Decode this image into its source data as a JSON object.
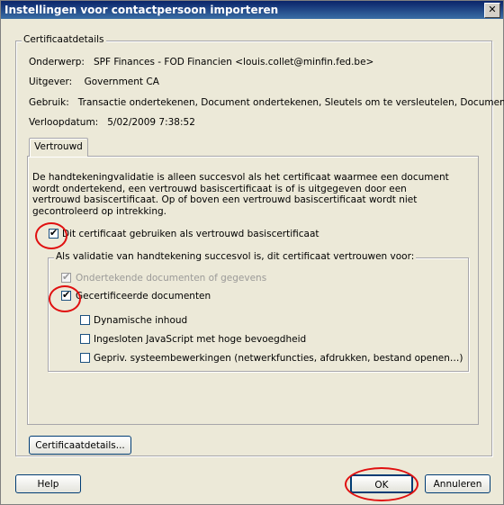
{
  "window": {
    "title": "Instellingen voor contactpersoon importeren",
    "close_symbol": "✕"
  },
  "certdetails": {
    "group_title": "Certificaatdetails",
    "subject_label": "Onderwerp:",
    "subject_value": "SPF Finances - FOD Financien <louis.collet@minfin.fed.be>",
    "issuer_label": "Uitgever:",
    "issuer_value": "Government CA",
    "usage_label": "Gebruik:",
    "usage_value": "Transactie ondertekenen, Document ondertekenen, Sleutels om te versleutelen, Document",
    "expiry_label": "Verloopdatum:",
    "expiry_value": "5/02/2009 7:38:52"
  },
  "tabs": [
    {
      "label": "Vertrouwd"
    }
  ],
  "trust": {
    "description": "De handtekeningvalidatie is alleen succesvol als het certificaat waarmee een document wordt ondertekend, een vertrouwd basiscertificaat is of is uitgegeven door een vertrouwd basiscertificaat. Op of boven een vertrouwd basiscertificaat wordt niet gecontroleerd op intrekking.",
    "root_checkbox": {
      "label": "Dit certificaat gebruiken als vertrouwd basiscertificaat",
      "checked": true
    },
    "subgroup_title": "Als validatie van handtekening succesvol is, dit certificaat vertrouwen voor:",
    "options": [
      {
        "label": "Ondertekende documenten of gegevens",
        "checked": true,
        "disabled": true
      },
      {
        "label": "Gecertificeerde documenten",
        "checked": true,
        "disabled": false
      },
      {
        "label": "Dynamische inhoud",
        "checked": false,
        "disabled": false
      },
      {
        "label": "Ingesloten JavaScript met hoge bevoegdheid",
        "checked": false,
        "disabled": false
      },
      {
        "label": "Gepriv. systeembewerkingen (netwerkfuncties, afdrukken, bestand openen…)",
        "checked": false,
        "disabled": false
      }
    ]
  },
  "buttons": {
    "certdetails": "Certificaatdetails...",
    "help": "Help",
    "ok": "OK",
    "cancel": "Annuleren"
  },
  "annotation_color": "#e01010"
}
